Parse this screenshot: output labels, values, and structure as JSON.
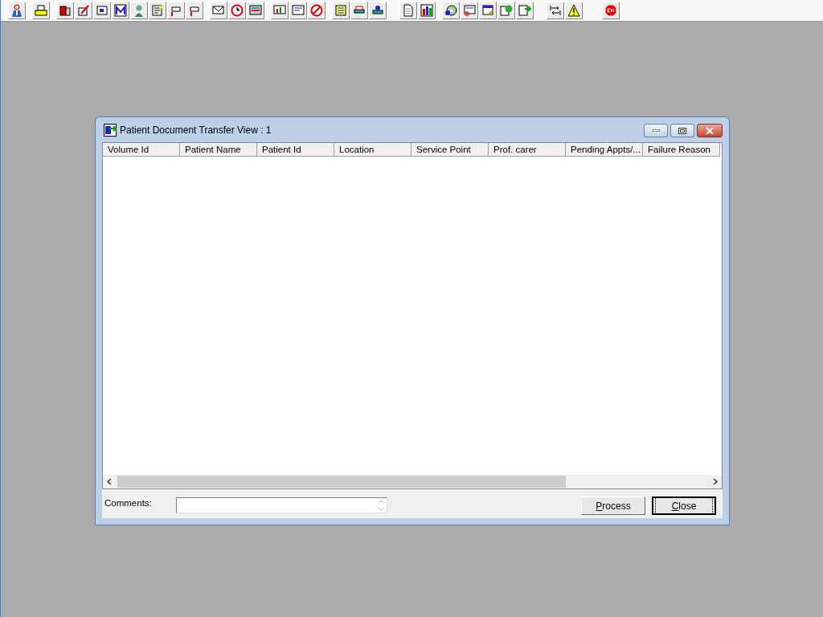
{
  "window": {
    "title": "Patient Document Transfer View : 1"
  },
  "table": {
    "columns": [
      "Volume Id",
      "Patient Name",
      "Patient Id",
      "Location",
      "Service Point",
      "Prof. carer",
      "Pending Appts/...",
      "Failure Reason"
    ]
  },
  "comments": {
    "label": "Comments:"
  },
  "buttons": [
    {
      "label": "Process",
      "default": false
    },
    {
      "label": "Close",
      "default": true
    }
  ]
}
